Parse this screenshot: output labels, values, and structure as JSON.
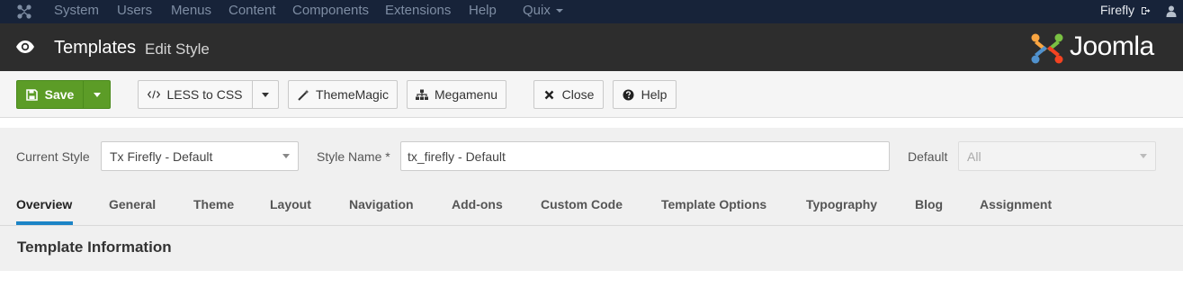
{
  "topnav": {
    "menu": [
      "System",
      "Users",
      "Menus",
      "Content",
      "Components",
      "Extensions",
      "Help",
      "Quix"
    ],
    "user": "Firefly"
  },
  "header": {
    "title": "Templates",
    "subtitle": "Edit Style",
    "brand": "Joomla"
  },
  "toolbar": {
    "save": "Save",
    "less_to_css": "LESS to CSS",
    "theme_magic": "ThemeMagic",
    "megamenu": "Megamenu",
    "close": "Close",
    "help": "Help"
  },
  "stylebar": {
    "current_style_label": "Current Style",
    "current_style_value": "Tx Firefly - Default",
    "style_name_label": "Style Name *",
    "style_name_value": "tx_firefly - Default",
    "default_label": "Default",
    "default_value": "All"
  },
  "tabs": [
    "Overview",
    "General",
    "Theme",
    "Layout",
    "Navigation",
    "Add-ons",
    "Custom Code",
    "Template Options",
    "Typography",
    "Blog",
    "Assignment"
  ],
  "active_tab": "Overview",
  "section": {
    "heading": "Template Information"
  },
  "colors": {
    "topnav_bg": "#172339",
    "header_bg": "#2d2d2d",
    "save_green": "#5c9c27",
    "tab_accent": "#1c84c6"
  }
}
